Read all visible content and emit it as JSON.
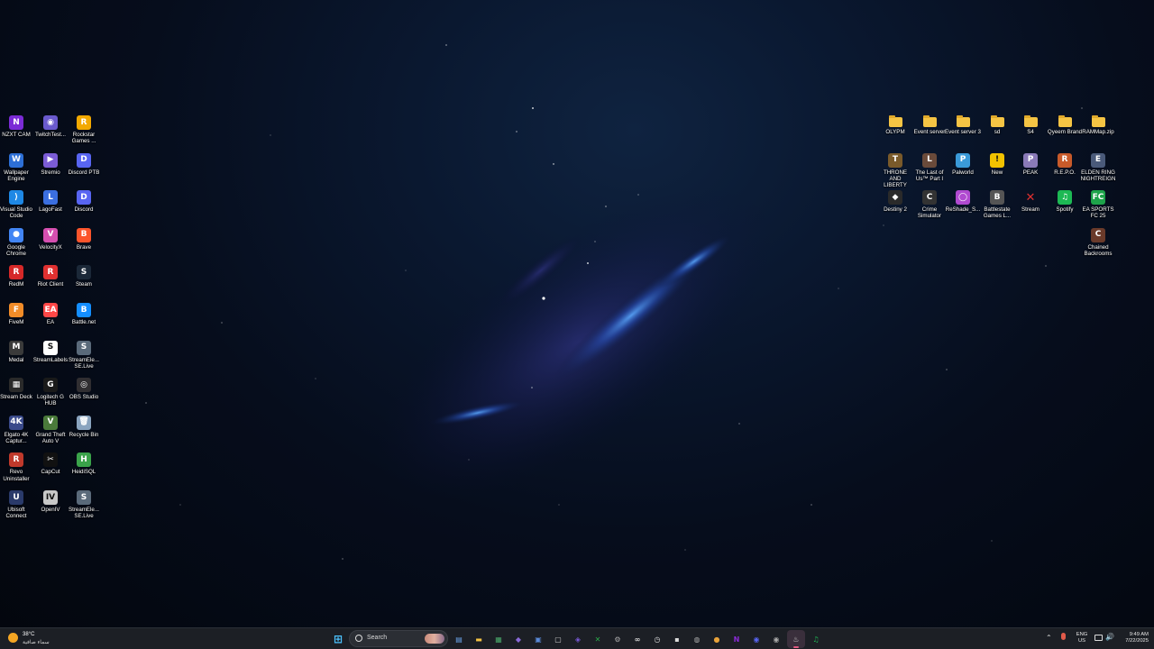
{
  "left_icons": [
    {
      "label": "NZXT CAM",
      "icon": "nzxt-cam-icon",
      "color": "#7b2bd6",
      "glyph": "N"
    },
    {
      "label": "TwitchTest...",
      "icon": "twitchtest-icon",
      "color": "#6a5acd",
      "glyph": "◉"
    },
    {
      "label": "Rockstar Games ...",
      "icon": "rockstar-icon",
      "color": "#f2a900",
      "glyph": "R"
    },
    {
      "label": "Wallpaper Engine",
      "icon": "wallpaper-engine-icon",
      "color": "#2d6fd6",
      "glyph": "W"
    },
    {
      "label": "Stremio",
      "icon": "stremio-icon",
      "color": "#7b5cd6",
      "glyph": "▶"
    },
    {
      "label": "Discord PTB",
      "icon": "discord-ptb-icon",
      "color": "#5865f2",
      "glyph": "D"
    },
    {
      "label": "Visual Studio Code",
      "icon": "vscode-icon",
      "color": "#1e88e5",
      "glyph": "⟩"
    },
    {
      "label": "LagoFast",
      "icon": "lagofast-icon",
      "color": "#3b6fe0",
      "glyph": "L"
    },
    {
      "label": "Discord",
      "icon": "discord-icon",
      "color": "#5865f2",
      "glyph": "D"
    },
    {
      "label": "Google Chrome",
      "icon": "chrome-icon",
      "color": "#4285f4",
      "glyph": "●"
    },
    {
      "label": "VelocityX",
      "icon": "velocityx-icon",
      "color": "#d64fb0",
      "glyph": "V"
    },
    {
      "label": "Brave",
      "icon": "brave-icon",
      "color": "#fb542b",
      "glyph": "B"
    },
    {
      "label": "RedM",
      "icon": "redm-icon",
      "color": "#d62828",
      "glyph": "R"
    },
    {
      "label": "Riot Client",
      "icon": "riot-client-icon",
      "color": "#e03030",
      "glyph": "R"
    },
    {
      "label": "Steam",
      "icon": "steam-icon",
      "color": "#1b2838",
      "glyph": "S"
    },
    {
      "label": "FiveM",
      "icon": "fivem-icon",
      "color": "#f28c28",
      "glyph": "F"
    },
    {
      "label": "EA",
      "icon": "ea-icon",
      "color": "#ff4747",
      "glyph": "EA"
    },
    {
      "label": "Battle.net",
      "icon": "battlenet-icon",
      "color": "#148eff",
      "glyph": "B"
    },
    {
      "label": "Medal",
      "icon": "medal-icon",
      "color": "#3a3a3a",
      "glyph": "M"
    },
    {
      "label": "StreamLabels",
      "icon": "streamlabels-icon",
      "color": "#ffffff",
      "glyph": "S"
    },
    {
      "label": "StreamEle... SE.Live",
      "icon": "streamelements-icon",
      "color": "#5a6a7a",
      "glyph": "S"
    },
    {
      "label": "Stream Deck",
      "icon": "stream-deck-icon",
      "color": "#2a2a2a",
      "glyph": "▦"
    },
    {
      "label": "Logitech G HUB",
      "icon": "logitech-ghub-icon",
      "color": "#1a1a1a",
      "glyph": "G"
    },
    {
      "label": "OBS Studio",
      "icon": "obs-studio-icon",
      "color": "#302e31",
      "glyph": "◎"
    },
    {
      "label": "Elgato 4K Captur...",
      "icon": "elgato-icon",
      "color": "#3a4a8a",
      "glyph": "4K"
    },
    {
      "label": "Grand Theft Auto V",
      "icon": "gtav-icon",
      "color": "#4a7a3a",
      "glyph": "V"
    },
    {
      "label": "Recycle Bin",
      "icon": "recycle-bin-icon",
      "color": "#8aa4bf",
      "glyph": "🗑"
    },
    {
      "label": "Revo Uninstaller",
      "icon": "revo-uninstaller-icon",
      "color": "#c0392b",
      "glyph": "R"
    },
    {
      "label": "CapCut",
      "icon": "capcut-icon",
      "color": "#111111",
      "glyph": "✂"
    },
    {
      "label": "HeidiSQL",
      "icon": "heidisql-icon",
      "color": "#3aa34a",
      "glyph": "H"
    },
    {
      "label": "Ubisoft Connect",
      "icon": "ubisoft-connect-icon",
      "color": "#2a3a6a",
      "glyph": "U"
    },
    {
      "label": "OpenIV",
      "icon": "openiv-icon",
      "color": "#c8c8c8",
      "glyph": "IV"
    },
    {
      "label": "StreamEle... SE.Live",
      "icon": "streamelements-icon",
      "color": "#5a6a7a",
      "glyph": "S"
    }
  ],
  "right_icons": [
    {
      "label": "OLYPM",
      "icon": "folder-icon",
      "type": "folder"
    },
    {
      "label": "Event server",
      "icon": "folder-icon",
      "type": "folder"
    },
    {
      "label": "Event server 3",
      "icon": "folder-icon",
      "type": "folder"
    },
    {
      "label": "sd",
      "icon": "folder-icon",
      "type": "folder"
    },
    {
      "label": "S4",
      "icon": "folder-icon",
      "type": "folder"
    },
    {
      "label": "Qyeem Brand",
      "icon": "folder-icon",
      "type": "folder"
    },
    {
      "label": "RAMMap.zip",
      "icon": "zip-folder-icon",
      "type": "folder"
    },
    {
      "label": "THRONE AND LIBERTY",
      "icon": "throne-and-liberty-icon",
      "color": "#7a5a2a",
      "glyph": "T"
    },
    {
      "label": "The Last of Us™ Part I",
      "icon": "last-of-us-icon",
      "color": "#6a4a3a",
      "glyph": "L"
    },
    {
      "label": "Palworld",
      "icon": "palworld-icon",
      "color": "#3a9ad9",
      "glyph": "P"
    },
    {
      "label": "New",
      "icon": "warning-icon",
      "color": "#f2c200",
      "glyph": "!"
    },
    {
      "label": "PEAK",
      "icon": "peak-icon",
      "color": "#8a7ab8",
      "glyph": "P"
    },
    {
      "label": "R.E.P.O.",
      "icon": "repo-icon",
      "color": "#c85a2a",
      "glyph": "R"
    },
    {
      "label": "ELDEN RING NIGHTREIGN",
      "icon": "elden-ring-icon",
      "color": "#4a5a7a",
      "glyph": "E"
    },
    {
      "label": "Destiny 2",
      "icon": "destiny2-icon",
      "color": "#2a2a2a",
      "glyph": "◆"
    },
    {
      "label": "Crime Simulator",
      "icon": "crime-simulator-icon",
      "color": "#333333",
      "glyph": "C"
    },
    {
      "label": "ReShade_S...",
      "icon": "reshade-icon",
      "color": "#b04ad0",
      "glyph": "◯"
    },
    {
      "label": "Battlestate Games L...",
      "icon": "battlestate-icon",
      "color": "#555555",
      "glyph": "B"
    },
    {
      "label": "Stream",
      "icon": "stream-x-icon",
      "color": "transparent",
      "glyph": "✕"
    },
    {
      "label": "Spotify",
      "icon": "spotify-icon",
      "color": "#1db954",
      "glyph": "♫"
    },
    {
      "label": "EA SPORTS FC 25",
      "icon": "ea-sports-fc-icon",
      "color": "#1ea34a",
      "glyph": "FC"
    },
    {
      "label": "Chained Backrooms",
      "icon": "chained-backrooms-icon",
      "color": "#6a3a2a",
      "glyph": "C"
    }
  ],
  "taskbar": {
    "weather_temp": "38°C",
    "weather_desc": "سماء صافية",
    "search_placeholder": "Search",
    "apps": [
      {
        "name": "start-button",
        "glyph": "⊞",
        "color": "#4cc2ff"
      },
      {
        "name": "widgets-icon",
        "glyph": "▤",
        "color": "#6aa3e8"
      },
      {
        "name": "file-explorer-icon",
        "glyph": "▬",
        "color": "#f5c444"
      },
      {
        "name": "nvidia-icon",
        "glyph": "▦",
        "color": "#4aa86a"
      },
      {
        "name": "copilot-icon",
        "glyph": "◆",
        "color": "#8a6ad8"
      },
      {
        "name": "photos-icon",
        "glyph": "▣",
        "color": "#5a8ad8"
      },
      {
        "name": "store-icon",
        "glyph": "▢",
        "color": "#cfcfcf"
      },
      {
        "name": "game-icon",
        "glyph": "◈",
        "color": "#7a5ad8"
      },
      {
        "name": "xbox-icon",
        "glyph": "✕",
        "color": "#2aa84a"
      },
      {
        "name": "settings-icon",
        "glyph": "⚙",
        "color": "#aaaaaa"
      },
      {
        "name": "rockstar-launcher-icon",
        "glyph": "∞",
        "color": "#dddddd"
      },
      {
        "name": "clock-icon",
        "glyph": "◷",
        "color": "#dddddd"
      },
      {
        "name": "terminal-icon",
        "glyph": "▪",
        "color": "#dddddd"
      },
      {
        "name": "disc-icon",
        "glyph": "◍",
        "color": "#aaaaaa"
      },
      {
        "name": "chrome-taskbar-icon",
        "glyph": "●",
        "color": "#e8a23a"
      },
      {
        "name": "nzxt-taskbar-icon",
        "glyph": "N",
        "color": "#8a2bd6"
      },
      {
        "name": "discord-taskbar-icon",
        "glyph": "◉",
        "color": "#5865f2"
      },
      {
        "name": "discord-ptb-taskbar-icon",
        "glyph": "◉",
        "color": "#aaaaaa"
      },
      {
        "name": "steam-taskbar-icon",
        "glyph": "♨",
        "color": "#dddddd"
      },
      {
        "name": "spotify-taskbar-icon",
        "glyph": "♫",
        "color": "#1db954"
      }
    ],
    "lang_top": "ENG",
    "lang_bottom": "US",
    "time": "9:49 AM",
    "date": "7/22/2025"
  }
}
